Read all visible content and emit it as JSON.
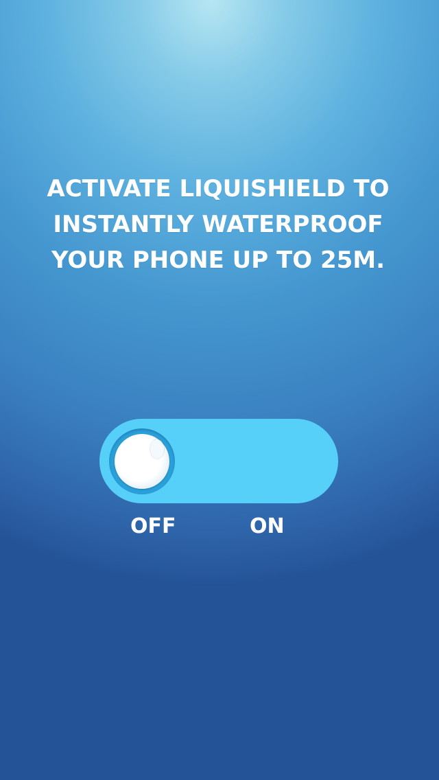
{
  "headline": {
    "lines": [
      "ACTIVATE LIQUISHIELD TO",
      "INSTANTLY WATERPROOF",
      "YOUR PHONE UP TO 25M."
    ]
  },
  "toggle": {
    "state": "off",
    "off_label": "OFF",
    "on_label": "ON"
  },
  "colors": {
    "track": "#56d0f8",
    "knob": "#ffffff",
    "text": "#ffffff",
    "background_top": "#b6e6f3",
    "background_bottom": "#255398"
  }
}
